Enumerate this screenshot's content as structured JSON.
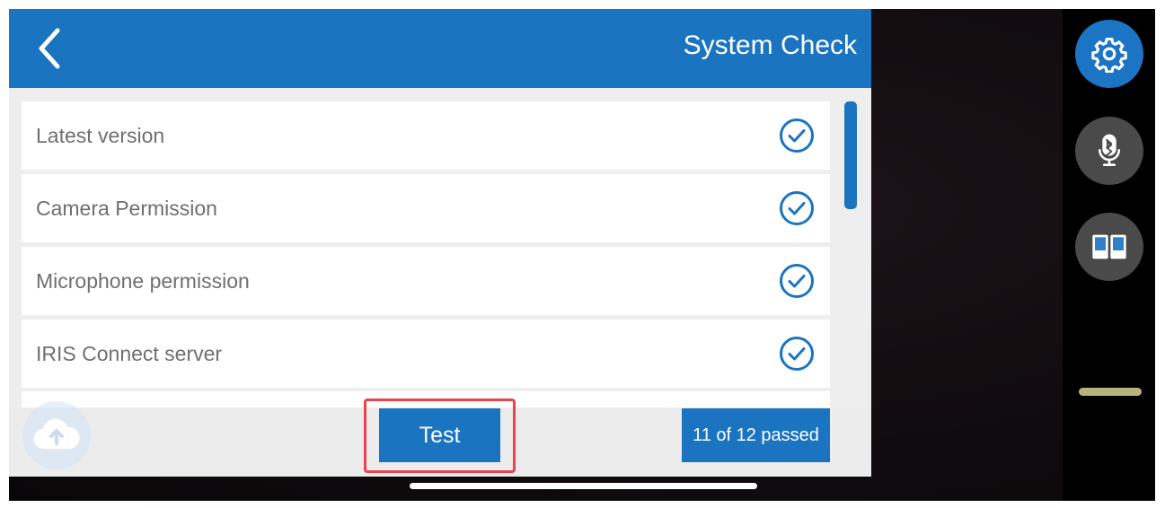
{
  "header": {
    "title": "System Check",
    "back_icon": "chevron-left-icon"
  },
  "checks": [
    {
      "label": "Latest version",
      "status": "passed",
      "icon": "check-circle-icon"
    },
    {
      "label": "Camera Permission",
      "status": "passed",
      "icon": "check-circle-icon"
    },
    {
      "label": "Microphone permission",
      "status": "passed",
      "icon": "check-circle-icon"
    },
    {
      "label": "IRIS Connect server",
      "status": "passed",
      "icon": "check-circle-icon"
    }
  ],
  "footer": {
    "test_label": "Test",
    "passed_summary": "11 of 12 passed"
  },
  "scroll": {
    "visible_fraction": 0.35
  },
  "rail": {
    "buttons": [
      "gear-icon",
      "bluetooth-mic-icon",
      "split-screen-icon"
    ]
  },
  "colors": {
    "primary": "#1b74c0",
    "highlight": "#e8434f",
    "rail_button": "#4a4a4a"
  }
}
